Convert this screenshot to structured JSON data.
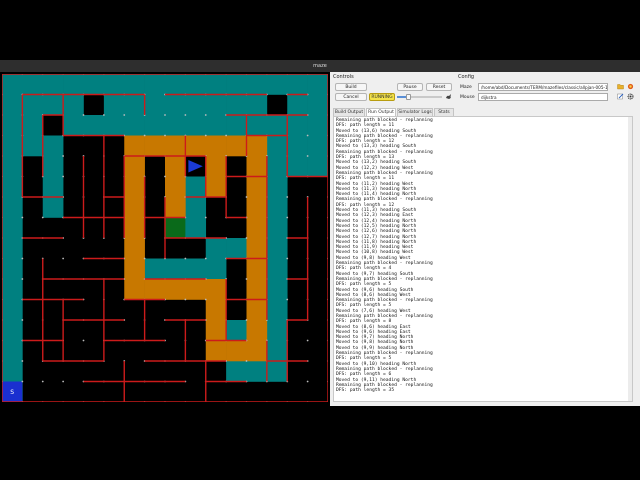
{
  "window": {
    "title": "maze"
  },
  "colors": {
    "visited": "#008080",
    "path": "#c87800",
    "wall": "#cc1b1b",
    "goal": "#0a6a1a",
    "start": "#1a2fd0",
    "agent": "#1a3ad6"
  },
  "controls": {
    "heading": "Controls",
    "build_label": "Build",
    "pause_label": "Pause",
    "reset_label": "Reset",
    "cancel_label": "Cancel",
    "status_label": "RUNNING"
  },
  "config": {
    "heading": "Config",
    "maze_label": "Maze",
    "maze_path": "/home/abd/Documents/TERM/mazefiles/classic/allpjan-005-198",
    "mouse_label": "Mouse",
    "mouse_value": "dijkstra"
  },
  "tabs": [
    "Build Output",
    "Run Output",
    "Simulator Logs",
    "Stats"
  ],
  "active_tab": 1,
  "maze": {
    "cols": 16,
    "rows": 16,
    "start_label": "S",
    "visited": [
      [
        0,
        0
      ],
      [
        1,
        0
      ],
      [
        2,
        0
      ],
      [
        3,
        0
      ],
      [
        4,
        0
      ],
      [
        5,
        0
      ],
      [
        6,
        0
      ],
      [
        7,
        0
      ],
      [
        8,
        0
      ],
      [
        9,
        0
      ],
      [
        10,
        0
      ],
      [
        11,
        0
      ],
      [
        12,
        0
      ],
      [
        13,
        0
      ],
      [
        14,
        0
      ],
      [
        15,
        0
      ],
      [
        0,
        1
      ],
      [
        1,
        1
      ],
      [
        2,
        1
      ],
      [
        3,
        1
      ],
      [
        5,
        1
      ],
      [
        6,
        1
      ],
      [
        7,
        1
      ],
      [
        8,
        1
      ],
      [
        9,
        1
      ],
      [
        10,
        1
      ],
      [
        11,
        1
      ],
      [
        12,
        1
      ],
      [
        14,
        1
      ],
      [
        15,
        1
      ],
      [
        0,
        2
      ],
      [
        1,
        2
      ],
      [
        3,
        2
      ],
      [
        4,
        2
      ],
      [
        5,
        2
      ],
      [
        6,
        2
      ],
      [
        7,
        2
      ],
      [
        8,
        2
      ],
      [
        9,
        2
      ],
      [
        10,
        2
      ],
      [
        11,
        2
      ],
      [
        12,
        2
      ],
      [
        13,
        2
      ],
      [
        14,
        2
      ],
      [
        15,
        2
      ],
      [
        0,
        3
      ],
      [
        1,
        3
      ],
      [
        2,
        3
      ],
      [
        12,
        3
      ],
      [
        13,
        3
      ],
      [
        14,
        3
      ],
      [
        15,
        3
      ],
      [
        0,
        4
      ],
      [
        2,
        4
      ],
      [
        13,
        4
      ],
      [
        14,
        4
      ],
      [
        15,
        4
      ],
      [
        0,
        5
      ],
      [
        2,
        5
      ],
      [
        9,
        5
      ],
      [
        13,
        5
      ],
      [
        0,
        6
      ],
      [
        2,
        6
      ],
      [
        8,
        6
      ],
      [
        9,
        6
      ],
      [
        13,
        6
      ],
      [
        0,
        7
      ],
      [
        8,
        7
      ],
      [
        9,
        7
      ],
      [
        13,
        7
      ],
      [
        0,
        8
      ],
      [
        10,
        8
      ],
      [
        11,
        8
      ],
      [
        13,
        8
      ],
      [
        0,
        9
      ],
      [
        7,
        9
      ],
      [
        8,
        9
      ],
      [
        9,
        9
      ],
      [
        10,
        9
      ],
      [
        13,
        9
      ],
      [
        0,
        10
      ],
      [
        13,
        10
      ],
      [
        0,
        11
      ],
      [
        13,
        11
      ],
      [
        0,
        12
      ],
      [
        11,
        12
      ],
      [
        13,
        12
      ],
      [
        0,
        13
      ],
      [
        13,
        13
      ],
      [
        0,
        14
      ],
      [
        11,
        14
      ],
      [
        12,
        14
      ],
      [
        13,
        14
      ],
      [
        0,
        15
      ]
    ],
    "path": [
      [
        6,
        3
      ],
      [
        7,
        3
      ],
      [
        8,
        3
      ],
      [
        9,
        3
      ],
      [
        10,
        3
      ],
      [
        11,
        3
      ],
      [
        12,
        3
      ],
      [
        6,
        4
      ],
      [
        8,
        4
      ],
      [
        10,
        4
      ],
      [
        12,
        4
      ],
      [
        6,
        5
      ],
      [
        8,
        5
      ],
      [
        10,
        5
      ],
      [
        12,
        5
      ],
      [
        6,
        6
      ],
      [
        8,
        6
      ],
      [
        12,
        6
      ],
      [
        6,
        7
      ],
      [
        12,
        7
      ],
      [
        6,
        8
      ],
      [
        12,
        8
      ],
      [
        6,
        9
      ],
      [
        12,
        9
      ],
      [
        6,
        10
      ],
      [
        7,
        10
      ],
      [
        8,
        10
      ],
      [
        9,
        10
      ],
      [
        10,
        10
      ],
      [
        12,
        10
      ],
      [
        10,
        11
      ],
      [
        12,
        11
      ],
      [
        10,
        12
      ],
      [
        12,
        12
      ],
      [
        10,
        13
      ],
      [
        11,
        13
      ],
      [
        12,
        13
      ]
    ],
    "hwalls": [
      [
        0,
        0,
        16
      ],
      [
        0,
        16,
        16
      ],
      [
        1,
        1,
        3
      ],
      [
        4,
        1,
        3
      ],
      [
        8,
        1,
        5
      ],
      [
        14,
        1,
        1
      ],
      [
        2,
        2,
        1
      ],
      [
        11,
        2,
        4
      ],
      [
        3,
        3,
        3
      ],
      [
        12,
        3,
        2
      ],
      [
        6,
        4,
        2
      ],
      [
        8,
        4,
        2
      ],
      [
        11,
        5,
        2
      ],
      [
        14,
        5,
        2
      ],
      [
        1,
        6,
        2
      ],
      [
        5,
        6,
        1
      ],
      [
        9,
        6,
        2
      ],
      [
        3,
        7,
        3
      ],
      [
        7,
        7,
        2
      ],
      [
        11,
        7,
        1
      ],
      [
        1,
        8,
        2
      ],
      [
        8,
        8,
        3
      ],
      [
        14,
        8,
        1
      ],
      [
        4,
        9,
        2
      ],
      [
        11,
        9,
        2
      ],
      [
        2,
        10,
        4
      ],
      [
        7,
        10,
        3
      ],
      [
        14,
        10,
        1
      ],
      [
        1,
        11,
        3
      ],
      [
        6,
        11,
        2
      ],
      [
        11,
        11,
        2
      ],
      [
        3,
        12,
        3
      ],
      [
        8,
        12,
        2
      ],
      [
        14,
        12,
        1
      ],
      [
        1,
        13,
        2
      ],
      [
        5,
        13,
        3
      ],
      [
        10,
        13,
        2
      ],
      [
        2,
        14,
        3
      ],
      [
        7,
        14,
        4
      ],
      [
        13,
        14,
        2
      ],
      [
        4,
        15,
        5
      ],
      [
        10,
        15,
        2
      ]
    ],
    "vwalls": [
      [
        0,
        0,
        16
      ],
      [
        16,
        0,
        16
      ],
      [
        1,
        1,
        5
      ],
      [
        2,
        2,
        3
      ],
      [
        3,
        1,
        2
      ],
      [
        4,
        4,
        4
      ],
      [
        5,
        3,
        5
      ],
      [
        6,
        4,
        4
      ],
      [
        7,
        1,
        1
      ],
      [
        7,
        5,
        3
      ],
      [
        8,
        6,
        3
      ],
      [
        9,
        3,
        2
      ],
      [
        10,
        4,
        2
      ],
      [
        11,
        4,
        3
      ],
      [
        12,
        2,
        2
      ],
      [
        13,
        4,
        8
      ],
      [
        14,
        2,
        3
      ],
      [
        15,
        6,
        6
      ],
      [
        2,
        9,
        5
      ],
      [
        3,
        11,
        3
      ],
      [
        5,
        10,
        4
      ],
      [
        7,
        11,
        2
      ],
      [
        9,
        12,
        2
      ],
      [
        11,
        10,
        3
      ],
      [
        13,
        13,
        2
      ],
      [
        14,
        12,
        3
      ],
      [
        6,
        14,
        2
      ],
      [
        10,
        14,
        2
      ]
    ],
    "goal": [
      8,
      7
    ],
    "start": [
      0,
      15
    ],
    "agent": [
      9,
      4
    ]
  },
  "log": [
    "Remaining path blocked - replanning",
    "DFS: path length = 11",
    "Moved to (13,6) heading South",
    "Remaining path blocked - replanning",
    "DFS: path length = 12",
    "Moved to (13,3) heading South",
    "Remaining path blocked - replanning",
    "DFS: path length = 13",
    "Moved to (13,2) heading South",
    "Moved to (12,2) heading West",
    "Remaining path blocked - replanning",
    "DFS: path length = 11",
    "Moved to (11,2) heading West",
    "Moved to (11,3) heading North",
    "Moved to (11,4) heading North",
    "Remaining path blocked - replanning",
    "DFS: path length = 12",
    "Moved to (11,3) heading South",
    "Moved to (12,3) heading East",
    "Moved to (12,4) heading North",
    "Moved to (12,5) heading North",
    "Moved to (12,6) heading North",
    "Moved to (12,7) heading North",
    "Moved to (11,8) heading North",
    "Moved to (11,9) heading West",
    "Moved to (10,8) heading West",
    "Moved to (9,8) heading West",
    "Remaining path blocked - replanning",
    "DFS: path length = 4",
    "Moved to (9,7) heading South",
    "Remaining path blocked - replanning",
    "DFS: path length = 5",
    "Moved to (9,6) heading South",
    "Moved to (8,6) heading West",
    "Remaining path blocked - replanning",
    "DFS: path length = 5",
    "Moved to (7,6) heading West",
    "Remaining path blocked - replanning",
    "DFS: path length = 8",
    "Moved to (8,6) heading East",
    "Moved to (9,6) heading East",
    "Moved to (9,7) heading North",
    "Moved to (9,8) heading North",
    "Moved to (9,9) heading North",
    "Remaining path blocked - replanning",
    "DFS: path length = 5",
    "Moved to (9,10) heading North",
    "Remaining path blocked - replanning",
    "DFS: path length = 6",
    "Moved to (9,11) heading North",
    "Remaining path blocked - replanning",
    "DFS: path length = 35"
  ]
}
